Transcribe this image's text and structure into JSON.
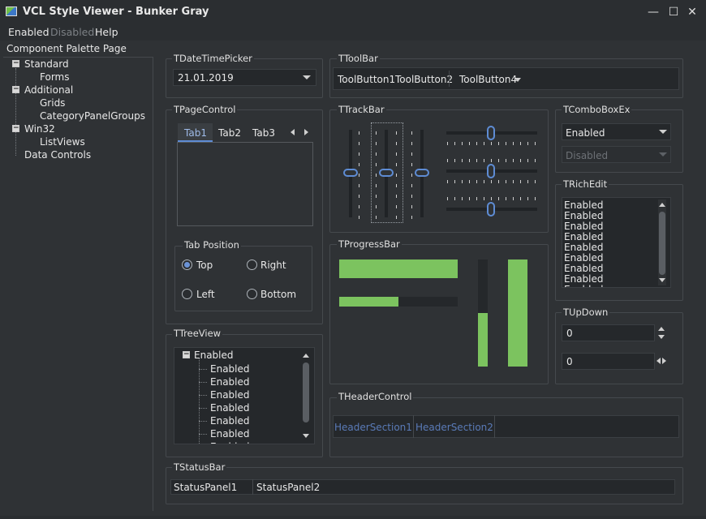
{
  "window": {
    "title": "VCL Style Viewer - Bunker Gray",
    "min": "—",
    "max": "☐",
    "close": "✕"
  },
  "menu": {
    "items": [
      "Enabled",
      "Disabled",
      "Help"
    ]
  },
  "palette": {
    "title": "Component Palette Page",
    "tree": [
      {
        "label": "Standard",
        "children": [
          "Forms"
        ]
      },
      {
        "label": "Additional",
        "children": [
          "Grids",
          "CategoryPanelGroups"
        ]
      },
      {
        "label": "Win32",
        "children": [
          "ListViews"
        ]
      },
      {
        "label": "Data Controls",
        "children": []
      }
    ],
    "expander": "−"
  },
  "datetime": {
    "label": "TDateTimePicker",
    "value": "21.01.2019"
  },
  "toolbar": {
    "label": "TToolBar",
    "buttons": [
      "ToolButton1",
      "ToolButton2",
      "ToolButton4"
    ]
  },
  "pagecontrol": {
    "label": "TPageControl",
    "tabs": [
      "Tab1",
      "Tab2",
      "Tab3"
    ],
    "active_tab": "Tab1"
  },
  "tabposition": {
    "label": "Tab Position",
    "options": [
      "Top",
      "Right",
      "Left",
      "Bottom"
    ],
    "selected": "Top"
  },
  "trackbar": {
    "label": "TTrackBar"
  },
  "comboboxex": {
    "label": "TComboBoxEx",
    "enabled_value": "Enabled",
    "disabled_value": "Disabled"
  },
  "richedit": {
    "label": "TRichEdit",
    "lines": [
      "Enabled",
      "Enabled",
      "Enabled",
      "Enabled",
      "Enabled",
      "Enabled",
      "Enabled",
      "Enabled",
      "Enabled"
    ]
  },
  "progressbar": {
    "label": "TProgressBar",
    "bars": [
      {
        "orientation": "horizontal",
        "fraction": 1.0
      },
      {
        "orientation": "horizontal",
        "fraction": 0.5
      },
      {
        "orientation": "vertical",
        "fraction": 0.5
      },
      {
        "orientation": "vertical",
        "fraction": 1.0
      }
    ]
  },
  "updown": {
    "label": "TUpDown",
    "value1": "0",
    "value2": "0"
  },
  "treeview": {
    "label": "TTreeView",
    "root": "Enabled",
    "children": [
      "Enabled",
      "Enabled",
      "Enabled",
      "Enabled",
      "Enabled",
      "Enabled",
      "Enabled"
    ]
  },
  "headercontrol": {
    "label": "THeaderControl",
    "sections": [
      "HeaderSection1",
      "HeaderSection2"
    ],
    "section_color": "#5a7bb8"
  },
  "statusbar": {
    "label": "TStatusBar",
    "panels": [
      "StatusPanel1",
      "StatusPanel2"
    ]
  },
  "colors": {
    "accent": "#5e8cd4",
    "progress": "#7cc35f",
    "background": "#2f3235"
  }
}
